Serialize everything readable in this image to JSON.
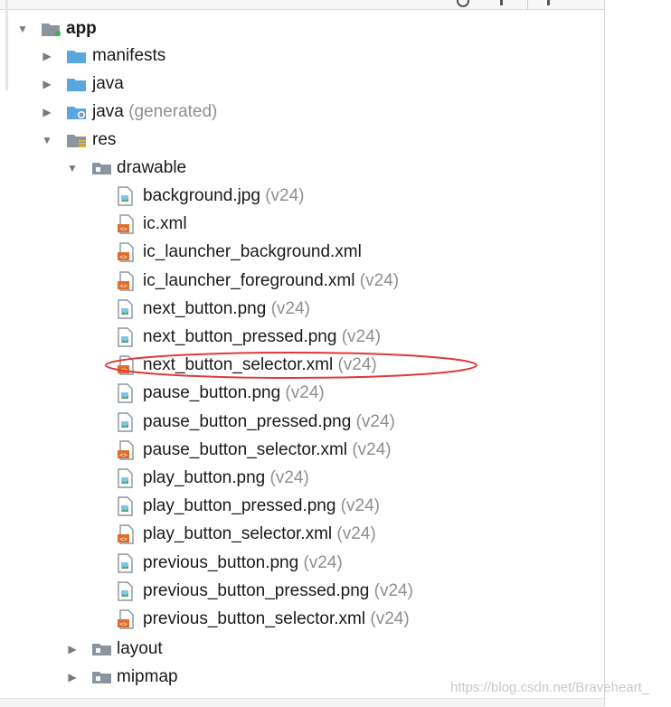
{
  "tree": {
    "app": {
      "label": "app"
    },
    "manifests": {
      "label": "manifests"
    },
    "java": {
      "label": "java"
    },
    "java_generated": {
      "label": "java",
      "suffix": "(generated)"
    },
    "res": {
      "label": "res"
    },
    "drawable": {
      "label": "drawable"
    },
    "files": [
      {
        "name": "background.jpg",
        "suffix": "(v24)",
        "kind": "image"
      },
      {
        "name": "ic.xml",
        "suffix": "",
        "kind": "xml"
      },
      {
        "name": "ic_launcher_background.xml",
        "suffix": "",
        "kind": "xml"
      },
      {
        "name": "ic_launcher_foreground.xml",
        "suffix": "(v24)",
        "kind": "xml"
      },
      {
        "name": "next_button.png",
        "suffix": "(v24)",
        "kind": "image"
      },
      {
        "name": "next_button_pressed.png",
        "suffix": "(v24)",
        "kind": "image"
      },
      {
        "name": "next_button_selector.xml",
        "suffix": "(v24)",
        "kind": "xml"
      },
      {
        "name": "pause_button.png",
        "suffix": "(v24)",
        "kind": "image"
      },
      {
        "name": "pause_button_pressed.png",
        "suffix": "(v24)",
        "kind": "image"
      },
      {
        "name": "pause_button_selector.xml",
        "suffix": "(v24)",
        "kind": "xml"
      },
      {
        "name": "play_button.png",
        "suffix": "(v24)",
        "kind": "image"
      },
      {
        "name": "play_button_pressed.png",
        "suffix": "(v24)",
        "kind": "image"
      },
      {
        "name": "play_button_selector.xml",
        "suffix": "(v24)",
        "kind": "xml"
      },
      {
        "name": "previous_button.png",
        "suffix": "(v24)",
        "kind": "image"
      },
      {
        "name": "previous_button_pressed.png",
        "suffix": "(v24)",
        "kind": "image"
      },
      {
        "name": "previous_button_selector.xml",
        "suffix": "(v24)",
        "kind": "xml"
      }
    ],
    "layout": {
      "label": "layout"
    },
    "mipmap": {
      "label": "mipmap"
    }
  },
  "annotation": {
    "color": "#e0383a",
    "target": "next_button_selector.xml"
  },
  "watermark": "https://blog.csdn.net/Braveheart_",
  "colors": {
    "folder_blue": "#5aa7e0",
    "folder_gray": "#8a95a0",
    "xml_orange": "#e06c2a",
    "suffix_gray": "#8f8f8f"
  }
}
